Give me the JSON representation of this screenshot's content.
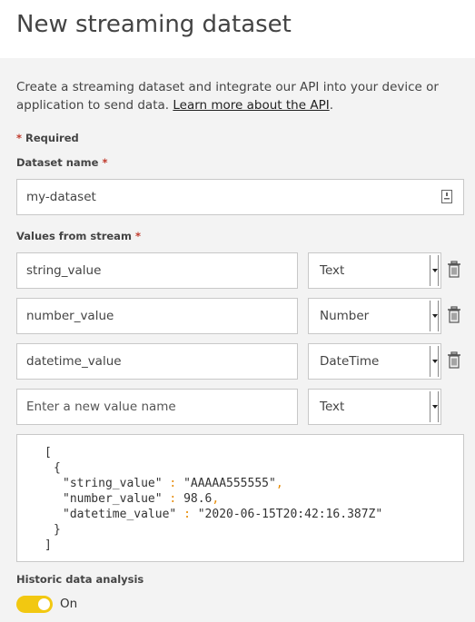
{
  "header": {
    "title": "New streaming dataset"
  },
  "intro": {
    "text": "Create a streaming dataset and integrate our API into your device or application to send data. ",
    "link": "Learn more about the API",
    "tail": "."
  },
  "required_note": {
    "asterisk": "*",
    "label": "Required"
  },
  "dataset_name": {
    "label": "Dataset name",
    "asterisk": "*",
    "value": "my-dataset",
    "icon": "document-icon"
  },
  "values": {
    "label": "Values from stream",
    "asterisk": "*",
    "rows": [
      {
        "name": "string_value",
        "type": "Text"
      },
      {
        "name": "number_value",
        "type": "Number"
      },
      {
        "name": "datetime_value",
        "type": "DateTime"
      }
    ],
    "new_row": {
      "placeholder": "Enter a new value name",
      "type": "Text"
    }
  },
  "json_preview": {
    "open_bracket": "[",
    "open_brace": "{",
    "lines": [
      {
        "key": "\"string_value\"",
        "colon": ":",
        "value": "\"AAAAA555555\"",
        "comma": ","
      },
      {
        "key": "\"number_value\"",
        "colon": ":",
        "value": "98.6",
        "comma": ","
      },
      {
        "key": "\"datetime_value\"",
        "colon": ":",
        "value": "\"2020-06-15T20:42:16.387Z\"",
        "comma": ""
      }
    ],
    "close_brace": "}",
    "close_bracket": "]"
  },
  "historic": {
    "label": "Historic data analysis",
    "toggle_state": "On",
    "toggle_color": "#f2c811"
  }
}
